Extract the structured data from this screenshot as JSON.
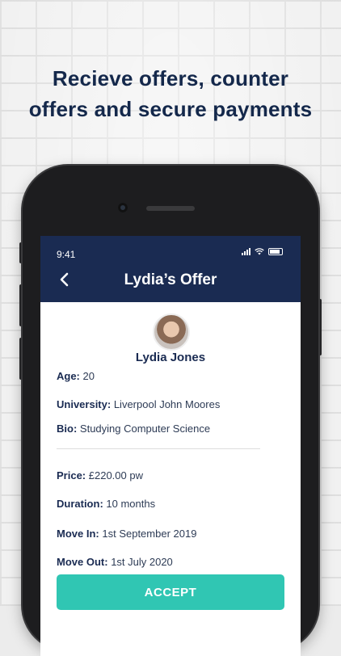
{
  "headline": {
    "line1": "Recieve offers, counter",
    "line2": "offers and secure payments"
  },
  "status": {
    "time": "9:41"
  },
  "navbar": {
    "title": "Lydia’s Offer",
    "back_icon": "chevron-left-icon"
  },
  "profile": {
    "name": "Lydia Jones",
    "age_label": "Age:",
    "age_value": "20",
    "university_label": "University:",
    "university_value": "Liverpool John Moores",
    "bio_label": "Bio:",
    "bio_value": "Studying Computer Science"
  },
  "offer": {
    "price_label": "Price:",
    "price_value": "£220.00 pw",
    "duration_label": "Duration:",
    "duration_value": "10 months",
    "move_in_label": "Move In:",
    "move_in_value": "1st September 2019",
    "move_out_label": "Move Out:",
    "move_out_value": "1st July 2020"
  },
  "actions": {
    "accept_label": "ACCEPT"
  },
  "colors": {
    "navy": "#1a2b52",
    "accent": "#30c6b3"
  }
}
